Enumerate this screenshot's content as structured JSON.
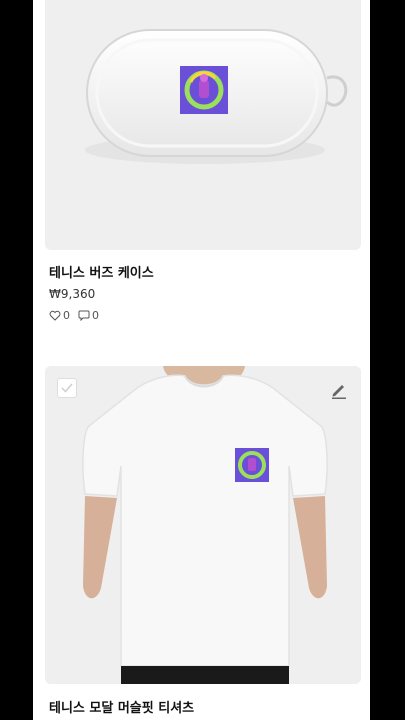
{
  "products": [
    {
      "title": "테니스 버즈 케이스",
      "price": "₩9,360",
      "likes": "0",
      "comments": "0"
    },
    {
      "title": "테니스 모달 머슬핏 티셔츠"
    }
  ],
  "colors": {
    "card_bg": "#efefef",
    "art_purple": "#6a4fd8",
    "art_green": "#9be05a"
  }
}
